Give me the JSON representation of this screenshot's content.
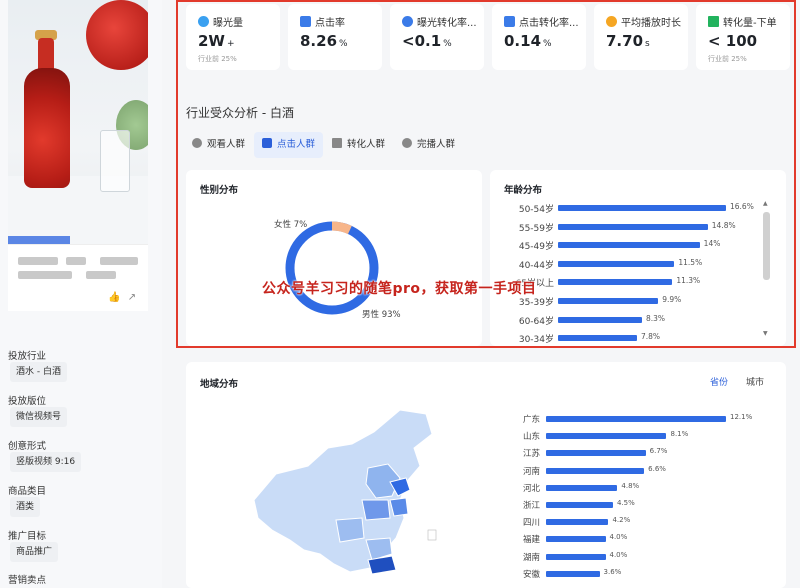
{
  "sidebar": {
    "meta": [
      {
        "label": "投放行业",
        "tag": "酒水 - 白酒"
      },
      {
        "label": "投放版位",
        "tag": "微信视频号"
      },
      {
        "label": "创意形式",
        "tag": "竖版视频 9:16"
      },
      {
        "label": "商品类目",
        "tag": "酒类"
      },
      {
        "label": "推广目标",
        "tag": "商品推广"
      },
      {
        "label": "营销卖点",
        "tag": ""
      }
    ]
  },
  "stats": [
    {
      "label": "曝光量",
      "value": "2W",
      "unit": "+",
      "sub": "行业前 25%",
      "color": "#3aa0f0"
    },
    {
      "label": "点击率",
      "value": "8.26",
      "unit": "%",
      "sub": "",
      "color": "#3b7be8"
    },
    {
      "label": "曝光转化率...",
      "value": "<0.1",
      "unit": "%",
      "sub": "",
      "color": "#3b7be8"
    },
    {
      "label": "点击转化率...",
      "value": "0.14",
      "unit": "%",
      "sub": "",
      "color": "#3b7be8"
    },
    {
      "label": "平均播放时长",
      "value": "7.70",
      "unit": "s",
      "sub": "",
      "color": "#f5a623"
    },
    {
      "label": "转化量-下单",
      "value": "< 100",
      "unit": "",
      "sub": "行业前 25%",
      "color": "#22b35e"
    }
  ],
  "audience": {
    "title": "行业受众分析 - 白酒",
    "tabs": [
      "观看人群",
      "点击人群",
      "转化人群",
      "完播人群"
    ],
    "active_tab": 1
  },
  "gender": {
    "title": "性别分布",
    "female_label": "女性 7%",
    "male_label": "男性 93%",
    "female_pct": 7,
    "male_pct": 93,
    "colors": {
      "male": "#2f6ae3",
      "female": "#f7b58a"
    }
  },
  "age": {
    "title": "年龄分布",
    "rows": [
      {
        "label": "50-54岁",
        "value": 16.6,
        "text": "16.6%"
      },
      {
        "label": "55-59岁",
        "value": 14.8,
        "text": "14.8%"
      },
      {
        "label": "45-49岁",
        "value": 14.0,
        "text": "14%"
      },
      {
        "label": "40-44岁",
        "value": 11.5,
        "text": "11.5%"
      },
      {
        "label": "65岁以上",
        "value": 11.3,
        "text": "11.3%"
      },
      {
        "label": "35-39岁",
        "value": 9.9,
        "text": "9.9%"
      },
      {
        "label": "60-64岁",
        "value": 8.3,
        "text": "8.3%"
      },
      {
        "label": "30-34岁",
        "value": 7.8,
        "text": "7.8%"
      }
    ]
  },
  "region": {
    "title": "地域分布",
    "toggle": [
      "省份",
      "城市"
    ],
    "rows": [
      {
        "label": "广东",
        "value": 12.1,
        "text": "12.1%"
      },
      {
        "label": "山东",
        "value": 8.1,
        "text": "8.1%"
      },
      {
        "label": "江苏",
        "value": 6.7,
        "text": "6.7%"
      },
      {
        "label": "河南",
        "value": 6.6,
        "text": "6.6%"
      },
      {
        "label": "河北",
        "value": 4.8,
        "text": "4.8%"
      },
      {
        "label": "浙江",
        "value": 4.5,
        "text": "4.5%"
      },
      {
        "label": "四川",
        "value": 4.2,
        "text": "4.2%"
      },
      {
        "label": "福建",
        "value": 4.0,
        "text": "4.0%"
      },
      {
        "label": "湖南",
        "value": 4.0,
        "text": "4.0%"
      },
      {
        "label": "安徽",
        "value": 3.6,
        "text": "3.6%"
      }
    ]
  },
  "watermark": "公众号羊习习的随笔pro，获取第一手项目"
}
